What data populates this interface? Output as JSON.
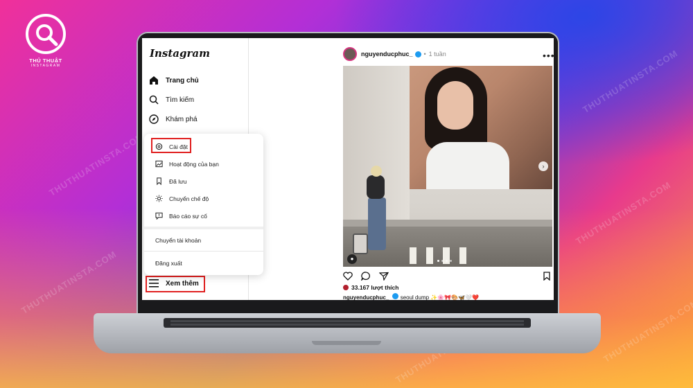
{
  "branding": {
    "site_title": "THỦ THUẬT",
    "site_subtitle": "INSTAGRAM",
    "watermark": "THUTHUATINSTA.COM"
  },
  "instagram": {
    "logo_text": "Instagram",
    "nav": [
      {
        "label": "Trang chủ",
        "icon": "home-icon",
        "active": true
      },
      {
        "label": "Tìm kiếm",
        "icon": "search-icon",
        "active": false
      },
      {
        "label": "Khám phá",
        "icon": "compass-icon",
        "active": false
      }
    ],
    "more_menu": {
      "items": [
        {
          "label": "Cài đặt",
          "icon": "settings-icon"
        },
        {
          "label": "Hoạt động của bạn",
          "icon": "activity-icon"
        },
        {
          "label": "Đã lưu",
          "icon": "bookmark-icon"
        },
        {
          "label": "Chuyển chế độ",
          "icon": "sun-icon"
        },
        {
          "label": "Báo cáo sự cố",
          "icon": "report-icon"
        }
      ],
      "switch_account": "Chuyển tài khoản",
      "logout": "Đăng xuất"
    },
    "see_more": "Xem thêm"
  },
  "post": {
    "username": "nguyenducphuc_",
    "separator": "•",
    "time": "1 tuần",
    "more": "•••",
    "likes": "33.167 lượt thích",
    "caption_user": "nguyenducphuc_",
    "caption_text": "seoul dump",
    "caption_emoji": "✨🌸🎀🎨🦋🤍❤️"
  },
  "colors": {
    "highlight": "#e02020",
    "verified": "#1d9bf0",
    "story_ring": "#d4357f"
  }
}
